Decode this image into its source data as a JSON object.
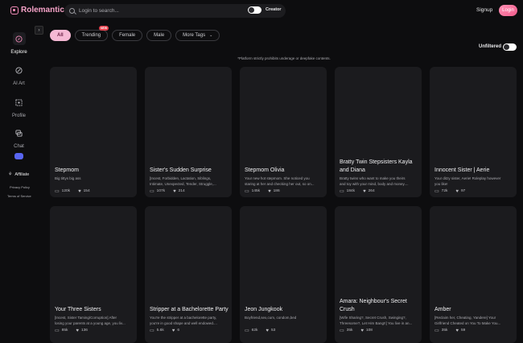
{
  "header": {
    "logo_text": "Rolemantic",
    "search_placeholder": "Login to search...",
    "creator_label": "Creator",
    "signup_label": "Signup",
    "login_label": "Login"
  },
  "sidebar": {
    "items": [
      {
        "label": "Explore",
        "icon": "compass-icon"
      },
      {
        "label": "AI Art",
        "icon": "brush-icon"
      },
      {
        "label": "Profile",
        "icon": "user-icon"
      },
      {
        "label": "Chat",
        "icon": "chat-icon"
      }
    ],
    "affiliate_label": "Affiliate",
    "privacy_label": "Privacy Policy",
    "terms_label": "Terms of Service"
  },
  "filters": {
    "all": "All",
    "trending": "Trending",
    "trending_badge": "NEW",
    "female": "Female",
    "male": "Male",
    "more_tags": "More Tags"
  },
  "unfiltered_label": "Unfiltered",
  "notice": "*Platform strictly prohibits underage or deepfake contents.",
  "cards_row1": [
    {
      "title_line1": "Stepmom",
      "title_line2": "",
      "desc_line1": "Big tittys big ass",
      "desc_line2": "",
      "chats": "120k",
      "likes": "154"
    },
    {
      "title_line1": "Sister's Sudden Surprise",
      "title_line2": "",
      "desc_line1": "[Incest, Forbidden, Lactation, Siblings,",
      "desc_line2": "Intimate, Unexpected, Tender, Struggle,...",
      "chats": "107k",
      "likes": "214"
    },
    {
      "title_line1": "Stepmom Olivia",
      "title_line2": "",
      "desc_line1": "Your new hot stepmom. She noticed you",
      "desc_line2": "staring at her and checking her out, so on...",
      "chats": "145k",
      "likes": "186"
    },
    {
      "title_line1": "Bratty Twin Stepsisters Kayla",
      "title_line2": "and Diana",
      "desc_line1": "Bratty twins who want to make you theirs",
      "desc_line2": "and toy with your mind, body and money....",
      "chats": "184k",
      "likes": "264"
    },
    {
      "title_line1": "Innocent Sister | Aerie",
      "title_line2": "",
      "desc_line1": "Your ditzy sister, Aerie! Roleplay however",
      "desc_line2": "you like!",
      "chats": "72k",
      "likes": "97"
    }
  ],
  "cards_row2": [
    {
      "title_line1": "Your Three Sisters",
      "title_line2": "",
      "desc_line1": "[Incest, Sister Taming/Corruption] After",
      "desc_line2": "losing your parents at a young age, you liv...",
      "chats": "85k",
      "likes": "136"
    },
    {
      "title_line1": "Stripper at a Bachelorette Party",
      "title_line2": "",
      "desc_line1": "You're the stripper at a bachelorette party,",
      "desc_line2": "you're in good shape and well endowed....",
      "chats": "5.6k",
      "likes": "6"
    },
    {
      "title_line1": "Jeon Jungkook",
      "title_line2": "",
      "desc_line1": "Boyfriend,sex,cum, condom,bed",
      "desc_line2": "",
      "chats": "62k",
      "likes": "53"
    },
    {
      "title_line1": "Amara: Neighbour's Secret",
      "title_line2": "Crush",
      "desc_line1": "[Wife Sharing?, Secret Crush, Swinging?,",
      "desc_line2": "Threesome?, Let Him Bang!!] You live in an...",
      "chats": "35k",
      "likes": "108"
    },
    {
      "title_line1": "Amber",
      "title_line2": "",
      "desc_line1": "[Reclaim her, Cheating, Yandere] Your",
      "desc_line2": "Girlfriend Cheated on You To Make You...",
      "chats": "35k",
      "likes": "59"
    }
  ]
}
